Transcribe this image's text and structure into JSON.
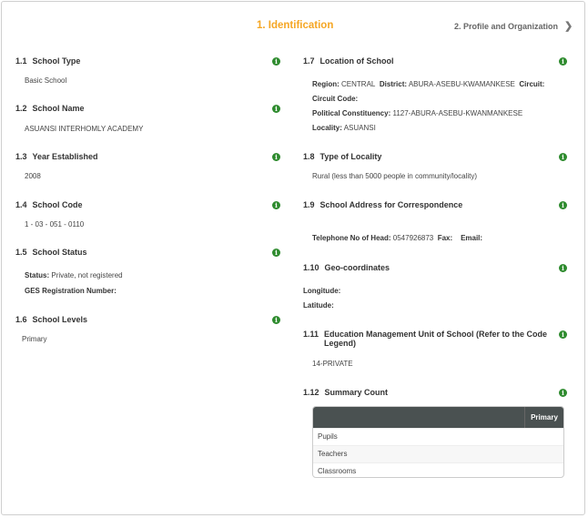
{
  "tabs": {
    "active": "1. Identification",
    "next": "2. Profile and Organization"
  },
  "left": {
    "s1_1": {
      "num": "1.1",
      "title": "School Type",
      "value": "Basic School"
    },
    "s1_2": {
      "num": "1.2",
      "title": "School Name",
      "value": "ASUANSI INTERHOMLY ACADEMY"
    },
    "s1_3": {
      "num": "1.3",
      "title": "Year Established",
      "value": "2008"
    },
    "s1_4": {
      "num": "1.4",
      "title": "School Code",
      "value": "1 - 03 - 051 - 0110"
    },
    "s1_5": {
      "num": "1.5",
      "title": "School Status",
      "status_label": "Status:",
      "status_value": "Private, not registered",
      "ges_label": "GES Registration Number:"
    },
    "s1_6": {
      "num": "1.6",
      "title": "School Levels",
      "value": "Primary"
    }
  },
  "right": {
    "s1_7": {
      "num": "1.7",
      "title": "Location of School",
      "region_label": "Region:",
      "region_value": "CENTRAL",
      "district_label": "District:",
      "district_value": "ABURA-ASEBU-KWAMANKESE",
      "circuit_label": "Circuit:",
      "circuit_code_label": "Circuit Code:",
      "constituency_label": "Political Constituency:",
      "constituency_value": "1127-ABURA-ASEBU-KWANMANKESE",
      "locality_label": "Locality:",
      "locality_value": "ASUANSI"
    },
    "s1_8": {
      "num": "1.8",
      "title": "Type of Locality",
      "value": "Rural (less than 5000 people in community/locality)"
    },
    "s1_9": {
      "num": "1.9",
      "title": "School Address for Correspondence",
      "tel_label": "Telephone No of Head:",
      "tel_value": "0547926873",
      "fax_label": "Fax:",
      "email_label": "Email:"
    },
    "s1_10": {
      "num": "1.10",
      "title": "Geo-coordinates",
      "longitude_label": "Longitude:",
      "latitude_label": "Latitude:"
    },
    "s1_11": {
      "num": "1.11",
      "title_line1": "Education Management Unit of School (Refer to the Code",
      "title_line2": "Legend)",
      "value": "14-PRIVATE"
    },
    "s1_12": {
      "num": "1.12",
      "title": "Summary Count",
      "table": {
        "column": "Primary",
        "rows": [
          "Pupils",
          "Teachers",
          "Classrooms"
        ]
      }
    }
  },
  "icons": {
    "info": "info-icon",
    "chevron": "chevron-right-icon",
    "info_color": "#2e8b2e",
    "accent": "#f5a623"
  }
}
